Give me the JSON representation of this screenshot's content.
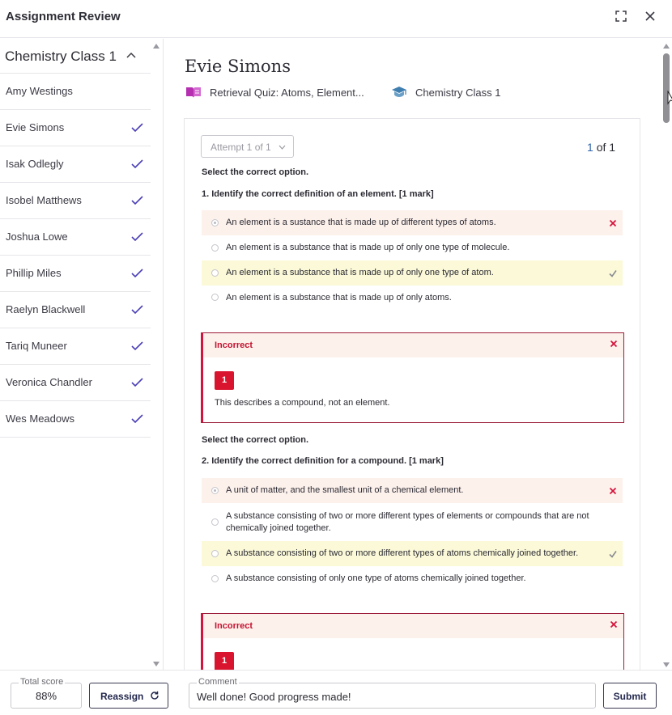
{
  "window": {
    "title": "Assignment Review"
  },
  "sidebar": {
    "class_name": "Chemistry Class 1",
    "students": [
      {
        "name": "Amy Westings",
        "checked": false
      },
      {
        "name": "Evie Simons",
        "checked": true
      },
      {
        "name": "Isak Odlegly",
        "checked": true
      },
      {
        "name": "Isobel Matthews",
        "checked": true
      },
      {
        "name": "Joshua Lowe",
        "checked": true
      },
      {
        "name": "Phillip Miles",
        "checked": true
      },
      {
        "name": "Raelyn Blackwell",
        "checked": true
      },
      {
        "name": "Tariq Muneer",
        "checked": true
      },
      {
        "name": "Veronica Chandler",
        "checked": true
      },
      {
        "name": "Wes Meadows",
        "checked": true
      }
    ]
  },
  "main": {
    "student_name": "Evie Simons",
    "quiz_title": "Retrieval Quiz: Atoms, Element...",
    "class_name": "Chemistry Class 1",
    "attempt_label": "Attempt 1 of 1",
    "pager": {
      "current": "1",
      "of": "of",
      "total": "1"
    },
    "questions": [
      {
        "instruction": "Select the correct option.",
        "text": "1. Identify the correct definition of an element. [1 mark]",
        "options": [
          {
            "text": "An element is a sustance that is made up of different types of atoms.",
            "state": "wrong",
            "selected": true
          },
          {
            "text": "An element is a substance that is made up of only one type of molecule.",
            "state": "none",
            "selected": false
          },
          {
            "text": "An element is a substance that is made up of only one type of atom.",
            "state": "right",
            "selected": false
          },
          {
            "text": "An element is a substance that is made up of only atoms.",
            "state": "none",
            "selected": false
          }
        ],
        "feedback": {
          "label": "Incorrect",
          "mark": "1",
          "comment": "This describes a compound, not an element."
        }
      },
      {
        "instruction": "Select the correct option.",
        "text": "2. Identify the correct definition for a compound. [1 mark]",
        "options": [
          {
            "text": "A unit of matter, and the smallest unit of a chemical element.",
            "state": "wrong",
            "selected": true
          },
          {
            "text": "A substance consisting of two or more different types of elements or compounds that are not chemically joined together.",
            "state": "none",
            "selected": false
          },
          {
            "text": "A substance consisting of two or more different types of atoms chemically joined together.",
            "state": "right",
            "selected": false
          },
          {
            "text": "A substance consisting of only one type of atoms chemically joined together.",
            "state": "none",
            "selected": false
          }
        ],
        "feedback": {
          "label": "Incorrect",
          "mark": "1",
          "comment": ""
        }
      }
    ]
  },
  "footer": {
    "score_label": "Total score",
    "score_value": "88%",
    "reassign_label": "Reassign",
    "comment_label": "Comment",
    "comment_value": "Well done! Good progress made!",
    "submit_label": "Submit"
  },
  "colors": {
    "accent": "#4a3fb5",
    "wrong_bg": "#fdf1ec",
    "right_bg": "#fbf9d8",
    "incorrect_red": "#d4143c"
  }
}
